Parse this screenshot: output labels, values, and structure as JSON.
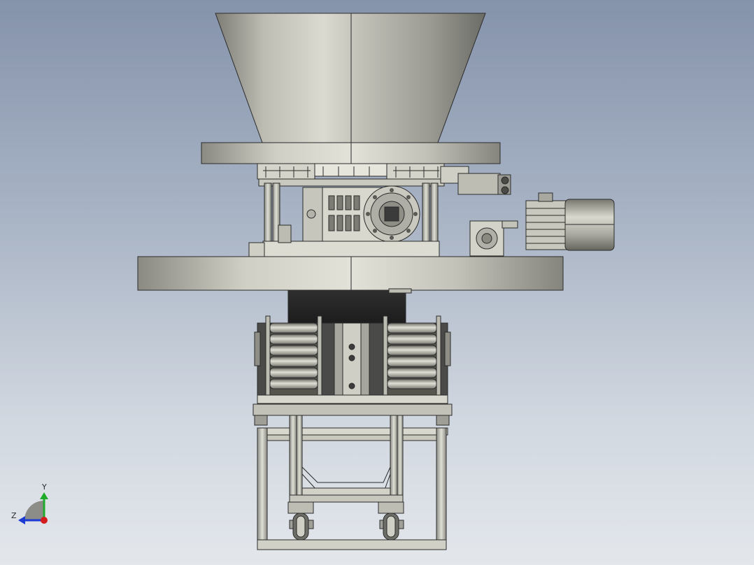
{
  "viewport": {
    "background_top": "#8593ab",
    "background_bottom": "#e3e7ec"
  },
  "machine": {
    "metal_light": "#d6d6cc",
    "metal_mid": "#a9a9a0",
    "metal_dark": "#6f6f69",
    "edge_color": "#2b2b2b"
  },
  "triad": {
    "x_axis_color": "#d41c1c",
    "y_axis_color": "#1faa2a",
    "z_axis_color": "#1c3bd4",
    "y_label": "Y",
    "z_label": "Z"
  }
}
